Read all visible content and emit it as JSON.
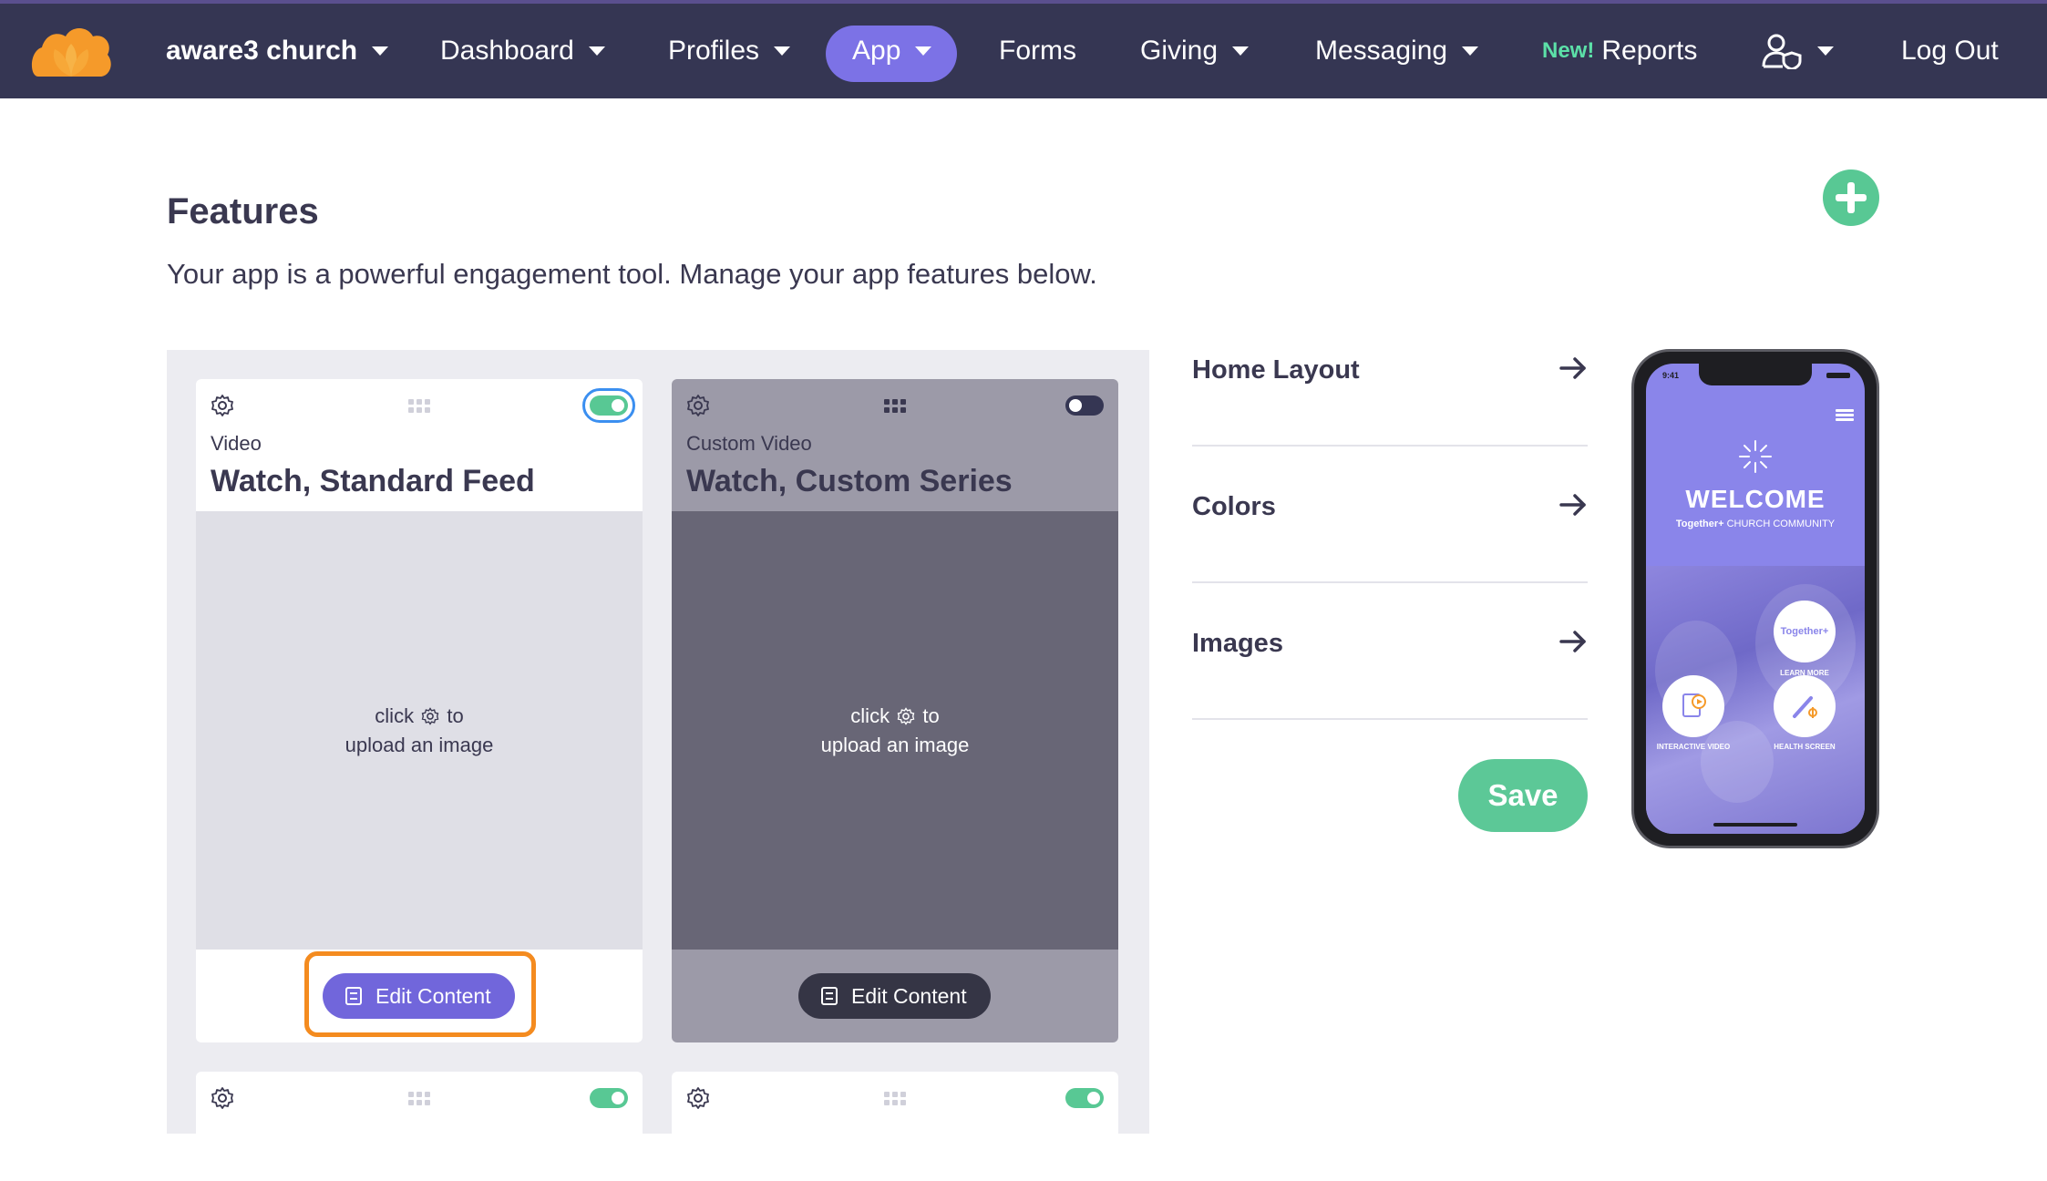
{
  "nav": {
    "brand": "aware3 church",
    "items": {
      "dashboard": "Dashboard",
      "profiles": "Profiles",
      "app": "App",
      "forms": "Forms",
      "giving": "Giving",
      "messaging": "Messaging",
      "reports_new_tag": "New!",
      "reports": "Reports",
      "logout": "Log Out"
    },
    "active_item": "App"
  },
  "header": {
    "title": "Features",
    "subtitle": "Your app is a powerful engagement tool. Manage your app features below."
  },
  "features": [
    {
      "type": "Video",
      "title": "Watch, Standard Feed",
      "enabled": true,
      "upload_hint_line1_before": "click",
      "upload_hint_line1_after": "to",
      "upload_hint_line2": "upload an image",
      "edit_label": "Edit Content"
    },
    {
      "type": "Custom Video",
      "title": "Watch, Custom Series",
      "enabled": false,
      "upload_hint_line1_before": "click",
      "upload_hint_line1_after": "to",
      "upload_hint_line2": "upload an image",
      "edit_label": "Edit Content"
    },
    {
      "enabled": true
    },
    {
      "enabled": true
    }
  ],
  "settings": {
    "home_layout": "Home Layout",
    "colors": "Colors",
    "images": "Images",
    "save_label": "Save"
  },
  "phone_preview": {
    "time": "9:41",
    "welcome": "WELCOME",
    "tagline_brand": "Together+",
    "tagline_rest": "CHURCH COMMUNITY",
    "badge": "Together+",
    "learn_more": "LEARN MORE",
    "interactive_video": "INTERACTIVE VIDEO",
    "health_screen": "HEALTH SCREEN"
  },
  "colors": {
    "nav_bg": "#353653",
    "accent": "#7c72e6",
    "success": "#5cc897",
    "highlight": "#f48b1f"
  },
  "icons": [
    "logo-icon",
    "user-shield-icon",
    "plus-icon",
    "gear-icon",
    "grip-icon",
    "document-icon",
    "arrow-right-icon",
    "menu-icon"
  ]
}
